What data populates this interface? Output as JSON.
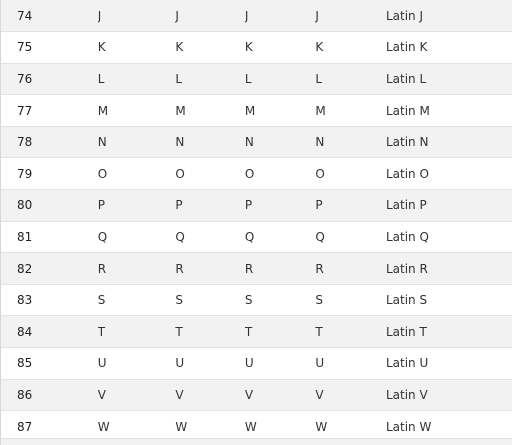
{
  "table": {
    "rows": [
      {
        "code": "74",
        "c1": "J",
        "c2": "J",
        "c3": "J",
        "c4": "J",
        "name": "Latin J"
      },
      {
        "code": "75",
        "c1": "K",
        "c2": "K",
        "c3": "K",
        "c4": "K",
        "name": "Latin K"
      },
      {
        "code": "76",
        "c1": "L",
        "c2": "L",
        "c3": "L",
        "c4": "L",
        "name": "Latin L"
      },
      {
        "code": "77",
        "c1": "M",
        "c2": "M",
        "c3": "M",
        "c4": "M",
        "name": "Latin M"
      },
      {
        "code": "78",
        "c1": "N",
        "c2": "N",
        "c3": "N",
        "c4": "N",
        "name": "Latin N"
      },
      {
        "code": "79",
        "c1": "O",
        "c2": "O",
        "c3": "O",
        "c4": "O",
        "name": "Latin O"
      },
      {
        "code": "80",
        "c1": "P",
        "c2": "P",
        "c3": "P",
        "c4": "P",
        "name": "Latin P"
      },
      {
        "code": "81",
        "c1": "Q",
        "c2": "Q",
        "c3": "Q",
        "c4": "Q",
        "name": "Latin Q"
      },
      {
        "code": "82",
        "c1": "R",
        "c2": "R",
        "c3": "R",
        "c4": "R",
        "name": "Latin R"
      },
      {
        "code": "83",
        "c1": "S",
        "c2": "S",
        "c3": "S",
        "c4": "S",
        "name": "Latin S"
      },
      {
        "code": "84",
        "c1": "T",
        "c2": "T",
        "c3": "T",
        "c4": "T",
        "name": "Latin T"
      },
      {
        "code": "85",
        "c1": "U",
        "c2": "U",
        "c3": "U",
        "c4": "U",
        "name": "Latin U"
      },
      {
        "code": "86",
        "c1": "V",
        "c2": "V",
        "c3": "V",
        "c4": "V",
        "name": "Latin V"
      },
      {
        "code": "87",
        "c1": "W",
        "c2": "W",
        "c3": "W",
        "c4": "W",
        "name": "Latin W"
      }
    ]
  }
}
